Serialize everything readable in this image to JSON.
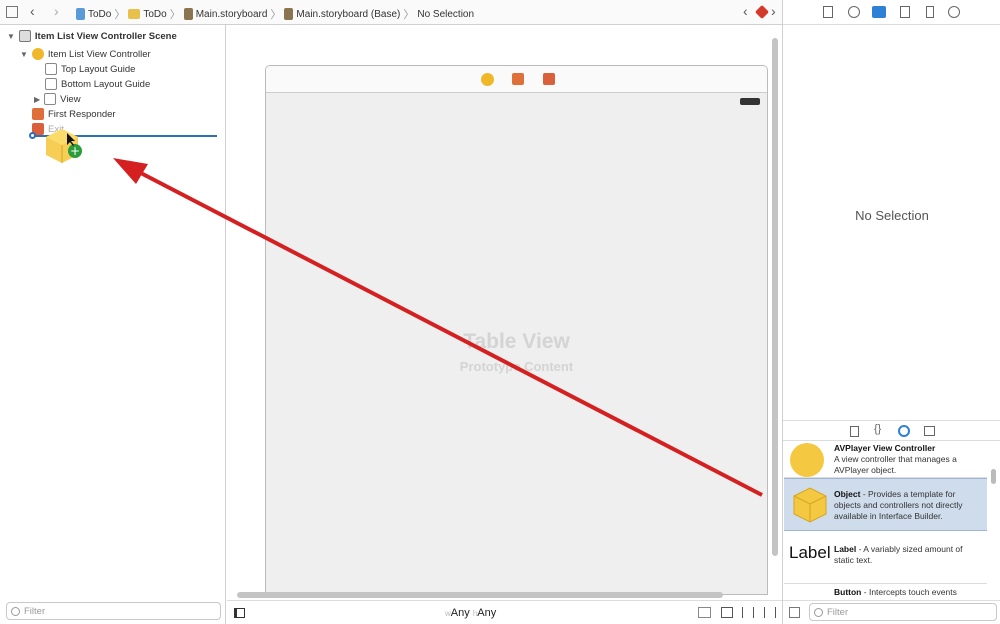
{
  "toolbar": {
    "breadcrumbs": [
      "ToDo",
      "ToDo",
      "Main.storyboard",
      "Main.storyboard (Base)",
      "No Selection"
    ]
  },
  "outline": {
    "scene": "Item List View Controller Scene",
    "controller": "Item List View Controller",
    "items": [
      "Top Layout Guide",
      "Bottom Layout Guide",
      "View",
      "First Responder",
      "Exit"
    ],
    "filter_placeholder": "Filter"
  },
  "canvas": {
    "title": "Table View",
    "subtitle": "Prototype Content",
    "size_w_prefix": "w",
    "size_w": "Any",
    "size_h_prefix": "h",
    "size_h": "Any"
  },
  "inspector": {
    "empty": "No Selection"
  },
  "library": {
    "items": [
      {
        "name": "AVPlayer View Controller",
        "desc": "A view controller that manages a AVPlayer object."
      },
      {
        "name": "Object",
        "desc": "Provides a template for objects and controllers not directly available in Interface Builder.",
        "selected": true
      },
      {
        "name": "Label",
        "desc": "A variably sized amount of static text.",
        "icon_text": "Label"
      },
      {
        "name": "Button",
        "desc": "Intercepts touch events"
      }
    ],
    "filter_placeholder": "Filter"
  },
  "colors": {
    "accent": "#2e6fb5",
    "arrow": "#d42020",
    "selection": "#cfdcec",
    "object_yellow": "#f5c842"
  }
}
